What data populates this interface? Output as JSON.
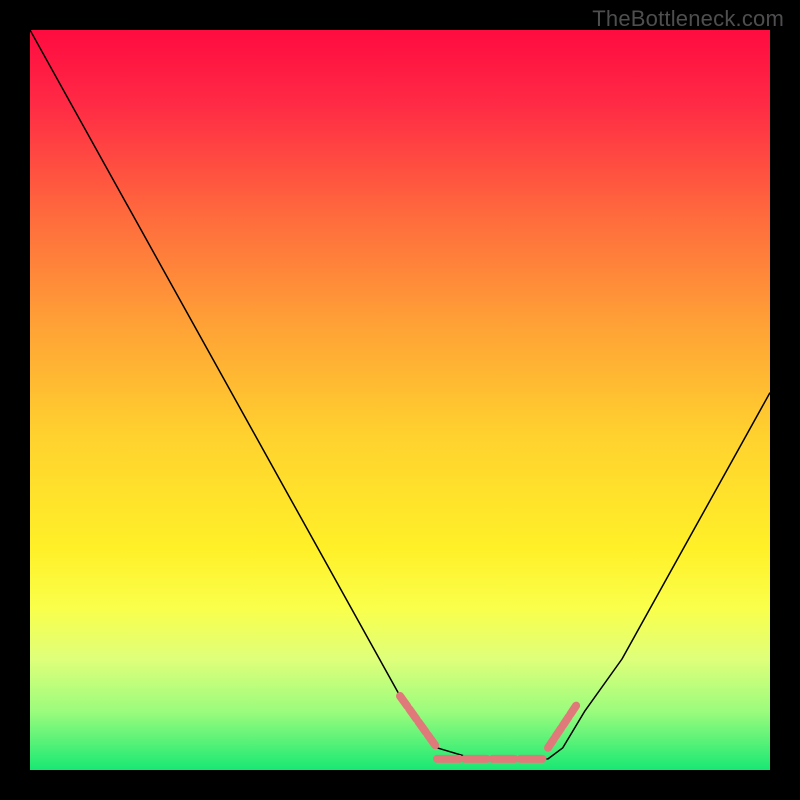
{
  "watermark": "TheBottleneck.com",
  "chart_data": {
    "type": "line",
    "title": "",
    "xlabel": "",
    "ylabel": "",
    "xlim": [
      0,
      100
    ],
    "ylim": [
      0,
      100
    ],
    "grid": false,
    "legend": false,
    "annotations": [],
    "series": [
      {
        "name": "bottleneck-curve",
        "color": "#000000",
        "stroke_width": 1.5,
        "x": [
          0,
          5,
          10,
          15,
          20,
          25,
          30,
          35,
          40,
          45,
          50,
          52,
          55,
          60,
          65,
          70,
          72,
          75,
          80,
          85,
          90,
          95,
          100
        ],
        "y": [
          100,
          91,
          82,
          73,
          64,
          55,
          46,
          37,
          28,
          19,
          10,
          7,
          3,
          1.5,
          1.2,
          1.5,
          3,
          8,
          15,
          24,
          33,
          42,
          51
        ]
      },
      {
        "name": "highlight-segment",
        "color": "#e07a7a",
        "stroke_width": 8,
        "x_segments": [
          [
            50,
            55
          ],
          [
            55,
            70
          ],
          [
            70,
            74
          ]
        ],
        "y_segments": [
          [
            10,
            3
          ],
          [
            1.5,
            1.5
          ],
          [
            3,
            9
          ]
        ]
      }
    ],
    "background_gradient": {
      "type": "vertical",
      "stops": [
        {
          "pos": 0.0,
          "color": "#ff0b40"
        },
        {
          "pos": 0.1,
          "color": "#ff2a45"
        },
        {
          "pos": 0.25,
          "color": "#ff6a3d"
        },
        {
          "pos": 0.4,
          "color": "#ffa236"
        },
        {
          "pos": 0.55,
          "color": "#ffd22e"
        },
        {
          "pos": 0.7,
          "color": "#fff028"
        },
        {
          "pos": 0.78,
          "color": "#faff4a"
        },
        {
          "pos": 0.85,
          "color": "#dfff7a"
        },
        {
          "pos": 0.92,
          "color": "#9cfc7d"
        },
        {
          "pos": 0.97,
          "color": "#4af077"
        },
        {
          "pos": 1.0,
          "color": "#17e874"
        }
      ]
    }
  }
}
